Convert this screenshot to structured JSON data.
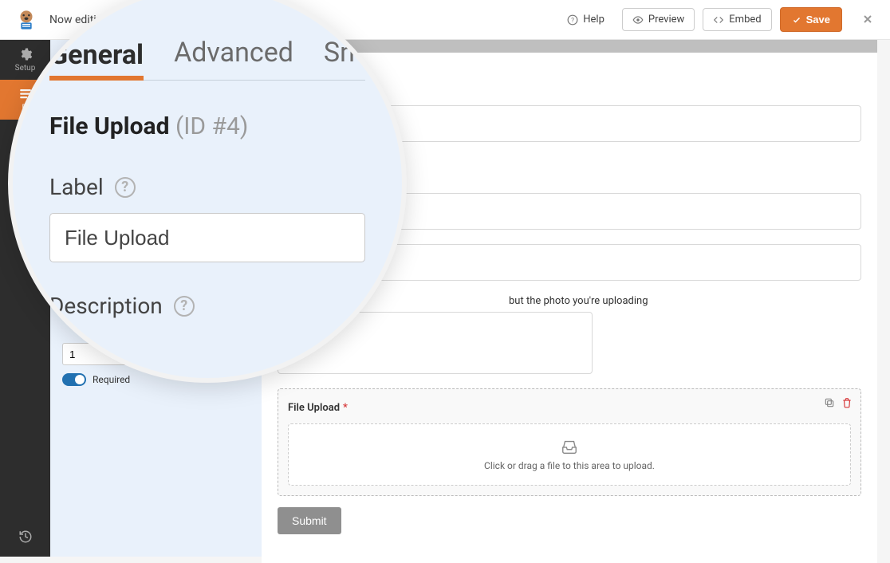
{
  "topbar": {
    "now_editing": "Now editing",
    "help": "Help",
    "preview": "Preview",
    "embed": "Embed",
    "save": "Save"
  },
  "rail": {
    "setup": "Setup",
    "fields": "Fi"
  },
  "zoom": {
    "tabs": {
      "general": "General",
      "advanced": "Advanced",
      "smart": "Sm"
    },
    "heading": "File Upload",
    "heading_id": "(ID #4)",
    "label": "Label",
    "label_value": "File Upload",
    "description": "Description"
  },
  "mini": {
    "value": "1",
    "required": "Required"
  },
  "preview": {
    "details_label": "but the photo you're uploading",
    "file_upload_label": "File Upload",
    "upload_hint": "Click or drag a file to this area to upload.",
    "submit": "Submit"
  }
}
